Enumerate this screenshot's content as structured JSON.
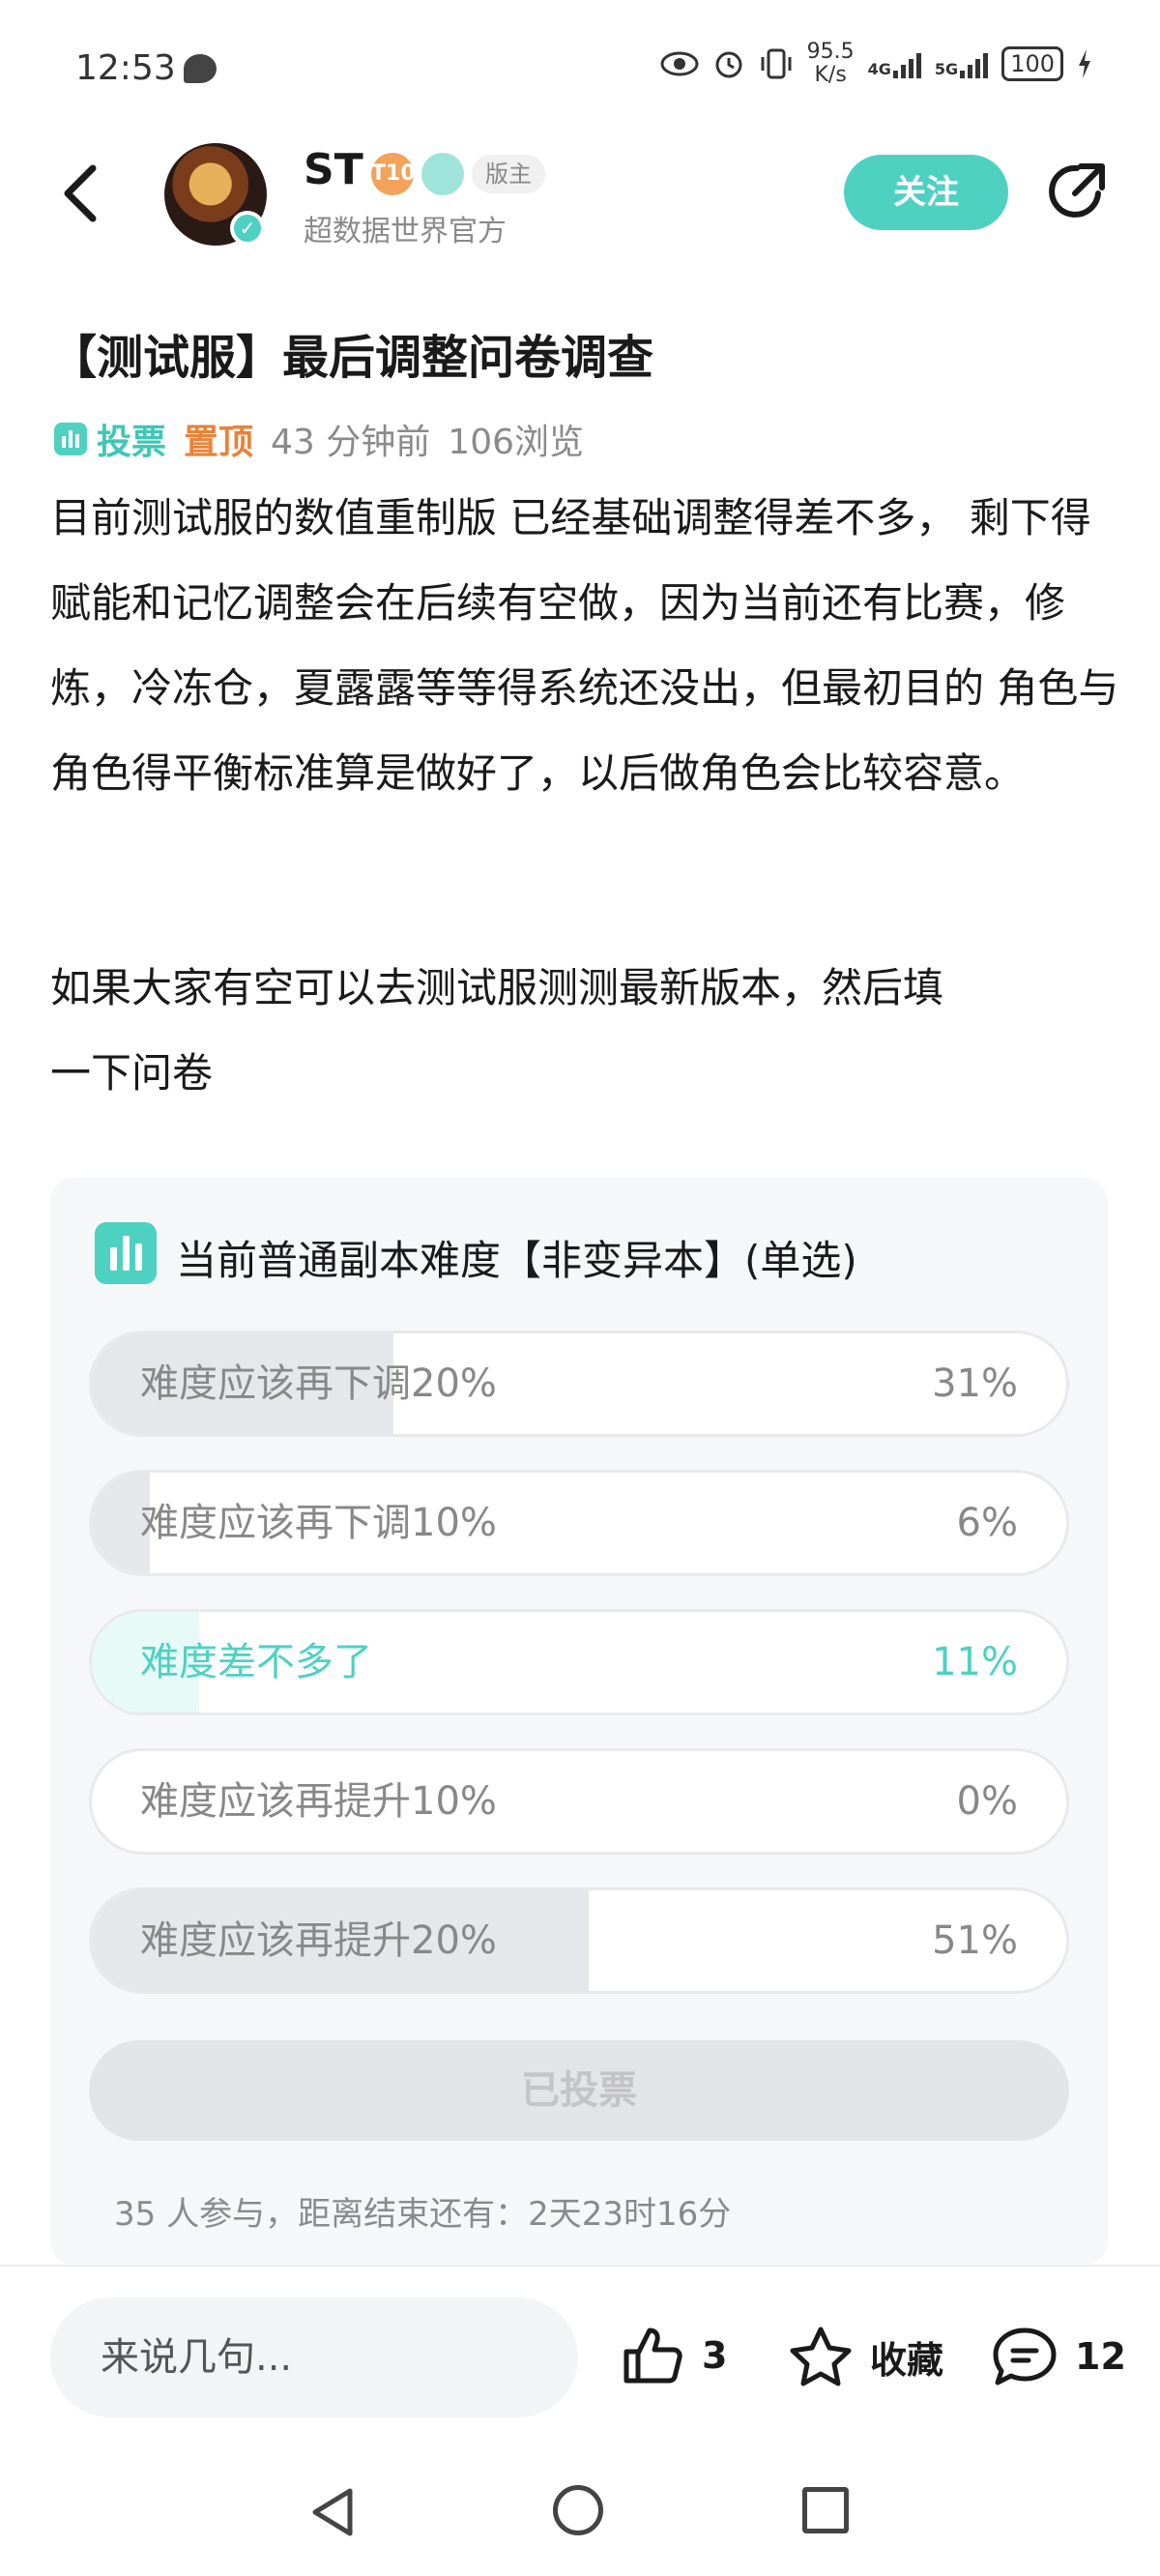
{
  "status": {
    "time": "12:53",
    "net_speed_value": "95.5",
    "net_speed_unit": "K/s",
    "net_4g": "4G",
    "net_5g": "5G",
    "battery": "100"
  },
  "header": {
    "username": "ST",
    "level_badge": "T10",
    "moderator_tag": "版主",
    "subtitle": "超数据世界官方",
    "follow_label": "关注"
  },
  "post": {
    "title": "【测试服】最后调整问卷调查",
    "vote_tag": "投票",
    "pin_tag": "置顶",
    "time_ago": "43 分钟前",
    "views": "106浏览",
    "paragraph1": "目前测试服的数值重制版 已经基础调整得差不多， 剩下得赋能和记忆调整会在后续有空做，因为当前还有比赛，修炼，冷冻仓，夏露露等等得系统还没出，但最初目的 角色与角色得平衡标准算是做好了，以后做角色会比较容意。",
    "paragraph2": "如果大家有空可以去测试服测测最新版本，然后填一下问卷"
  },
  "poll": {
    "title": "当前普通副本难度【非变异本】(单选)",
    "options": [
      {
        "label": "难度应该再下调20%",
        "percent": "31%",
        "value": 31,
        "selected": false
      },
      {
        "label": "难度应该再下调10%",
        "percent": "6%",
        "value": 6,
        "selected": false
      },
      {
        "label": "难度差不多了",
        "percent": "11%",
        "value": 11,
        "selected": true
      },
      {
        "label": "难度应该再提升10%",
        "percent": "0%",
        "value": 0,
        "selected": false
      },
      {
        "label": "难度应该再提升20%",
        "percent": "51%",
        "value": 51,
        "selected": false
      }
    ],
    "voted_label": "已投票",
    "footer": "35 人参与，距离结束还有：2天23时16分"
  },
  "bottom_bar": {
    "comment_placeholder": "来说几句...",
    "likes": "3",
    "favorite_label": "收藏",
    "comments": "12"
  },
  "colors": {
    "accent": "#4fd1c1",
    "pin": "#e8833a"
  }
}
